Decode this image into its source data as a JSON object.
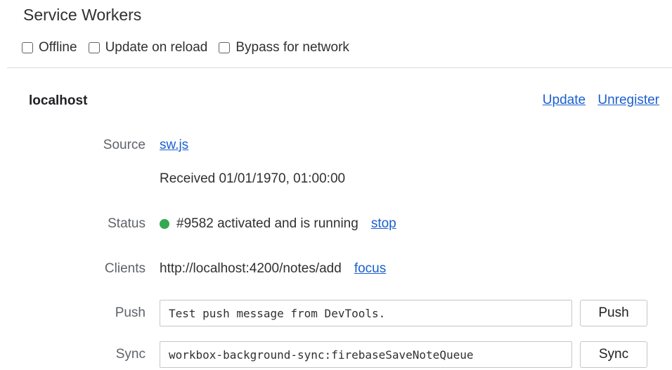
{
  "header": {
    "title": "Service Workers"
  },
  "options": {
    "offline": "Offline",
    "update_on_reload": "Update on reload",
    "bypass_for_network": "Bypass for network"
  },
  "worker": {
    "host": "localhost",
    "update_link": "Update",
    "unregister_link": "Unregister",
    "source_label": "Source",
    "source_file": "sw.js",
    "received": "Received 01/01/1970, 01:00:00",
    "status_label": "Status",
    "status_text": "#9582 activated and is running",
    "status_color": "#34a853",
    "stop_link": "stop",
    "clients_label": "Clients",
    "client_url": "http://localhost:4200/notes/add",
    "focus_link": "focus",
    "push_label": "Push",
    "push_value": "Test push message from DevTools.",
    "push_button": "Push",
    "sync_label": "Sync",
    "sync_value": "workbox-background-sync:firebaseSaveNoteQueue",
    "sync_button": "Sync"
  }
}
